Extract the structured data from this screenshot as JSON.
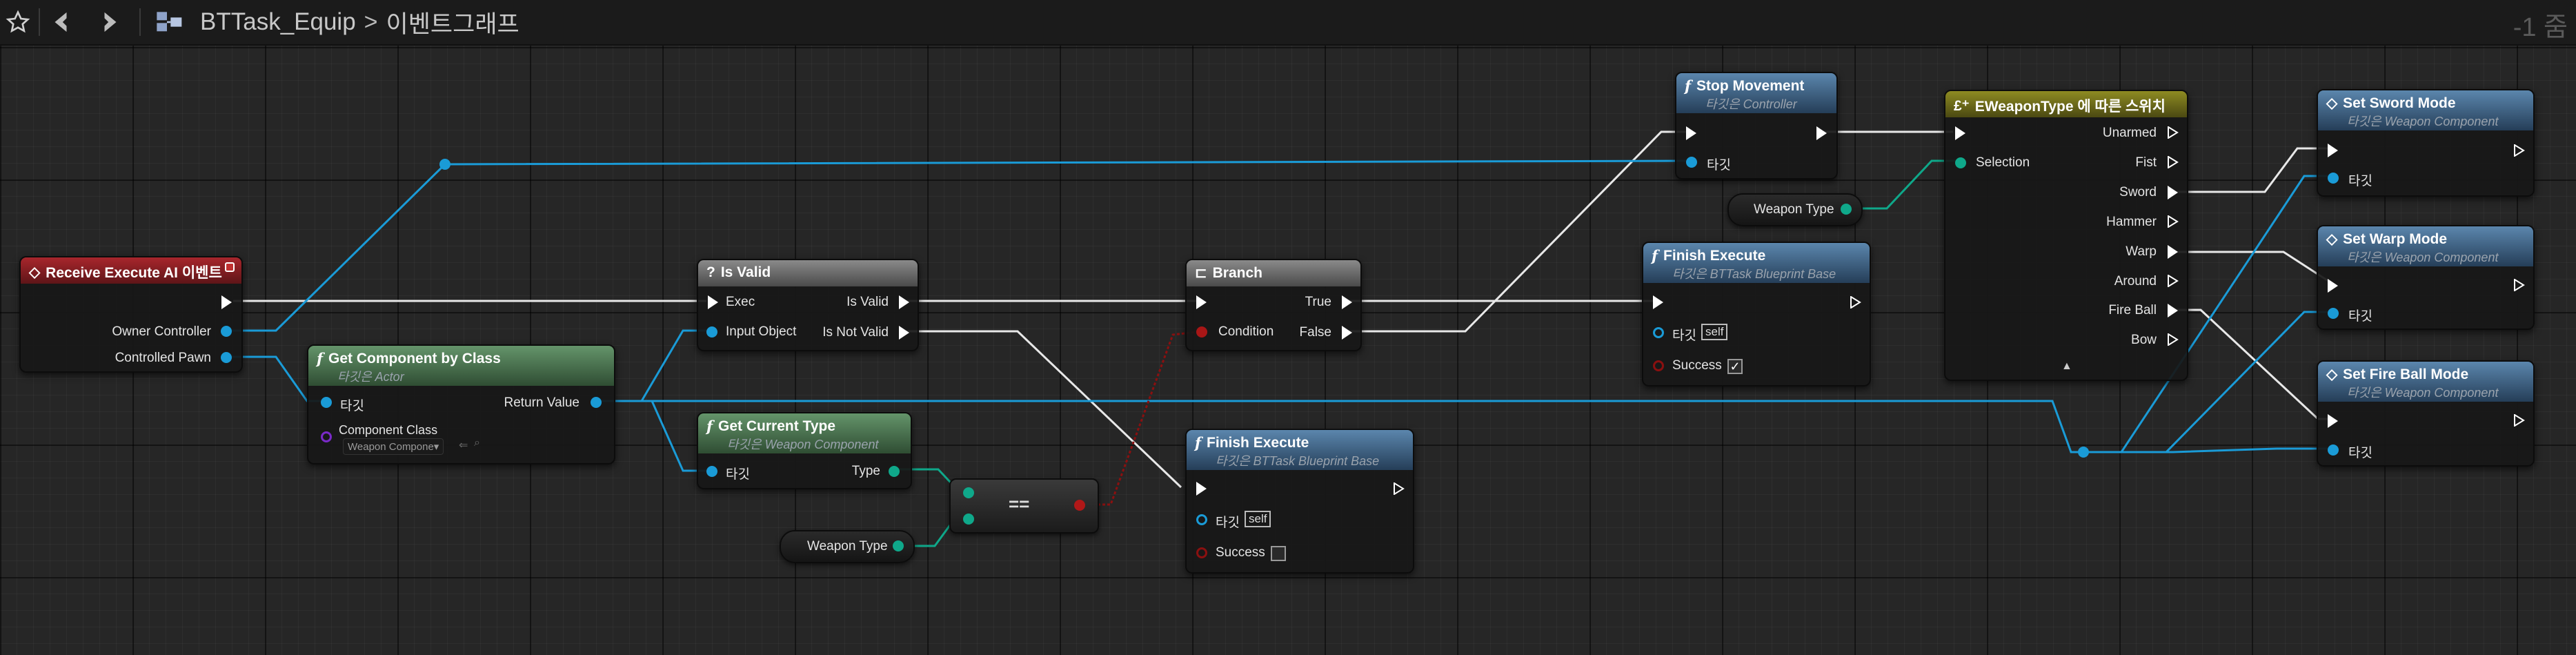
{
  "toolbar": {
    "favorite_icon": "star-outline-icon",
    "back_icon": "arrow-back-icon",
    "forward_icon": "arrow-forward-icon",
    "graph_icon": "blueprint-graph-icon"
  },
  "breadcrumb": {
    "asset": "BTTask_Equip",
    "separator": ">",
    "graph": "이벤트그래프"
  },
  "zoom": "-1 줌",
  "colors": {
    "exec": "#ffffff",
    "object": "#1a9bd7",
    "enum": "#0fa88a",
    "bool": "#9a1010",
    "class": "#7a2ac8"
  },
  "nodes": {
    "receive_execute": {
      "title": "Receive Execute AI 이벤트",
      "pin_owner": "Owner Controller",
      "pin_pawn": "Controlled Pawn"
    },
    "get_component": {
      "title": "Get Component by Class",
      "subtitle": "타깃은 Actor",
      "pin_target": "타깃",
      "pin_return": "Return Value",
      "pin_class": "Component Class",
      "class_value": "Weapon Compone▾"
    },
    "is_valid": {
      "title": "Is Valid",
      "pin_exec": "Exec",
      "pin_input": "Input Object",
      "pin_valid": "Is Valid",
      "pin_not_valid": "Is Not Valid"
    },
    "get_current_type": {
      "title": "Get Current Type",
      "subtitle": "타깃은 Weapon Component",
      "pin_target": "타깃",
      "pin_type": "Type"
    },
    "weapon_type_var1": "Weapon Type",
    "weapon_type_var2": "Weapon Type",
    "equals_label": "==",
    "branch": {
      "title": "Branch",
      "pin_condition": "Condition",
      "pin_true": "True",
      "pin_false": "False"
    },
    "finish_execute_1": {
      "title": "Finish Execute",
      "subtitle": "타깃은 BTTask Blueprint Base",
      "pin_target": "타깃",
      "self_value": "self",
      "pin_success": "Success",
      "success_checked": false
    },
    "finish_execute_2": {
      "title": "Finish Execute",
      "subtitle": "타깃은 BTTask Blueprint Base",
      "pin_target": "타깃",
      "self_value": "self",
      "pin_success": "Success",
      "success_checked": true,
      "check_mark": "✓"
    },
    "stop_movement": {
      "title": "Stop Movement",
      "subtitle": "타깃은 Controller",
      "pin_target": "타깃"
    },
    "switch": {
      "title": "EWeaponType 에 따른 스위치",
      "pin_selection": "Selection",
      "outputs": [
        "Unarmed",
        "Fist",
        "Sword",
        "Hammer",
        "Warp",
        "Around",
        "Fire Ball",
        "Bow"
      ],
      "expand_icon": "▲"
    },
    "set_sword": {
      "title": "Set Sword Mode",
      "subtitle": "타깃은 Weapon Component",
      "pin_target": "타깃"
    },
    "set_warp": {
      "title": "Set Warp Mode",
      "subtitle": "타깃은 Weapon Component",
      "pin_target": "타깃"
    },
    "set_fireball": {
      "title": "Set Fire Ball Mode",
      "subtitle": "타깃은 Weapon Component",
      "pin_target": "타깃"
    }
  }
}
